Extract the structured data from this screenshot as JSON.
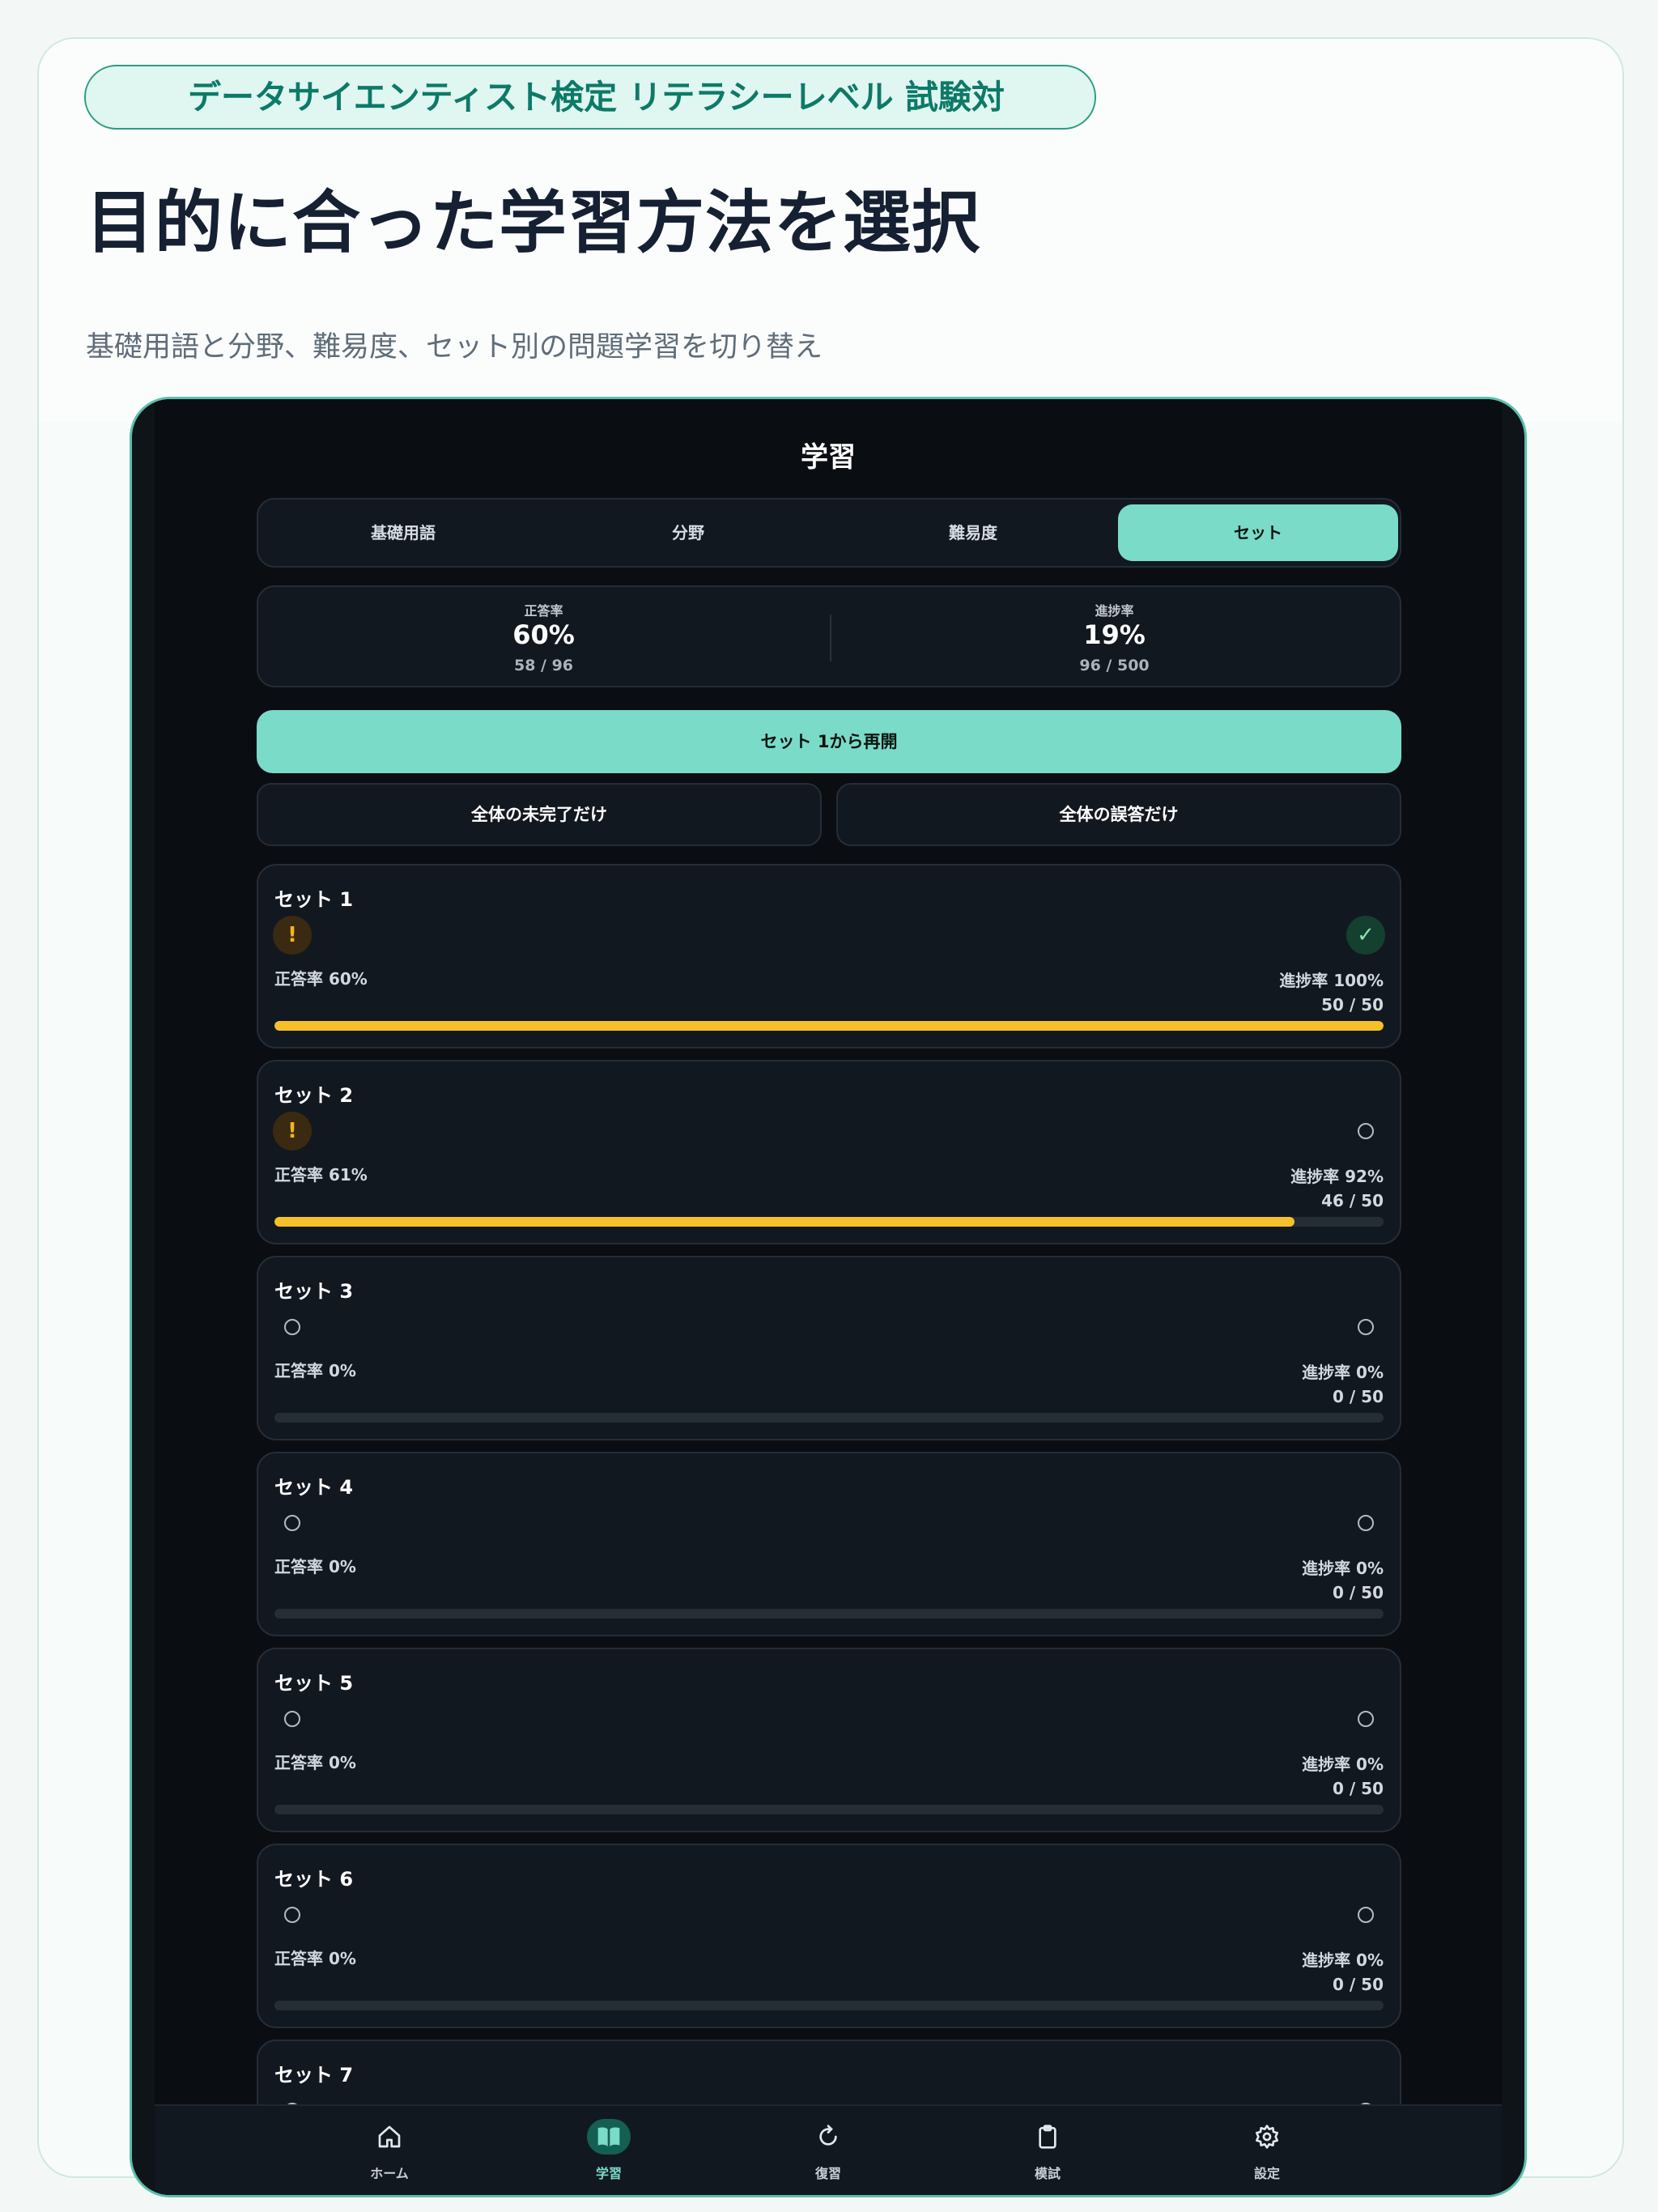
{
  "promo": {
    "badge": "データサイエンティスト検定 リテラシーレベル 試験対",
    "headline": "目的に合った学習方法を選択",
    "subline": "基礎用語と分野、難易度、セット別の問題学習を切り替え"
  },
  "app": {
    "title": "学習",
    "tabs": [
      {
        "label": "基礎用語",
        "active": false
      },
      {
        "label": "分野",
        "active": false
      },
      {
        "label": "難易度",
        "active": false
      },
      {
        "label": "セット",
        "active": true
      }
    ],
    "stats": {
      "accuracy": {
        "label": "正答率",
        "value": "60%",
        "sub": "58 / 96"
      },
      "progress": {
        "label": "進捗率",
        "value": "19%",
        "sub": "96 / 500"
      }
    },
    "resume_button": "セット 1から再開",
    "filter_incomplete": "全体の未完了だけ",
    "filter_wrong": "全体の誤答だけ",
    "sets": [
      {
        "title": "セット 1",
        "accuracy": "正答率 60%",
        "progress": "進捗率 100%",
        "count": "50 / 50",
        "left_status": "warning",
        "right_status": "complete",
        "fill": 1.0
      },
      {
        "title": "セット 2",
        "accuracy": "正答率 61%",
        "progress": "進捗率 92%",
        "count": "46 / 50",
        "left_status": "warning",
        "right_status": "empty",
        "fill": 0.92
      },
      {
        "title": "セット 3",
        "accuracy": "正答率 0%",
        "progress": "進捗率 0%",
        "count": "0 / 50",
        "left_status": "empty",
        "right_status": "empty",
        "fill": 0
      },
      {
        "title": "セット 4",
        "accuracy": "正答率 0%",
        "progress": "進捗率 0%",
        "count": "0 / 50",
        "left_status": "empty",
        "right_status": "empty",
        "fill": 0
      },
      {
        "title": "セット 5",
        "accuracy": "正答率 0%",
        "progress": "進捗率 0%",
        "count": "0 / 50",
        "left_status": "empty",
        "right_status": "empty",
        "fill": 0
      },
      {
        "title": "セット 6",
        "accuracy": "正答率 0%",
        "progress": "進捗率 0%",
        "count": "0 / 50",
        "left_status": "empty",
        "right_status": "empty",
        "fill": 0
      },
      {
        "title": "セット 7",
        "accuracy": "",
        "progress": "",
        "count": "",
        "left_status": "empty",
        "right_status": "empty",
        "fill": 0
      }
    ],
    "nav": [
      {
        "label": "ホーム",
        "icon": "home-icon",
        "active": false
      },
      {
        "label": "学習",
        "icon": "book-icon",
        "active": true
      },
      {
        "label": "復習",
        "icon": "refresh-icon",
        "active": false
      },
      {
        "label": "模試",
        "icon": "clipboard-icon",
        "active": false
      },
      {
        "label": "設定",
        "icon": "gear-icon",
        "active": false
      }
    ],
    "colors": {
      "accent": "#79dbc8",
      "progress_bar": "#f5c02a",
      "warning": "#f5b221",
      "background": "#0a0e12",
      "card": "#121820"
    }
  }
}
